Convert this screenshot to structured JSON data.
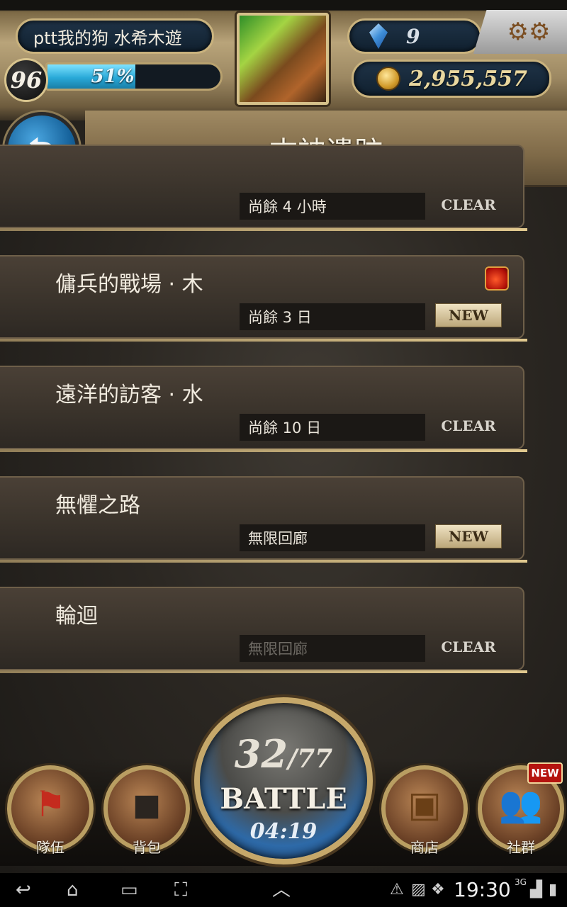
{
  "player": {
    "name": "ptt我的狗 水希木遊",
    "level": "96",
    "exp_text": "51%",
    "exp_fraction": 0.51,
    "gems": "9",
    "coins": "2,955,557"
  },
  "header": {
    "title": "古神遺跡"
  },
  "stages": [
    {
      "title": "",
      "time": "尚餘 4 小時",
      "tag": "CLEAR",
      "tag_type": "clear",
      "has_icon": false
    },
    {
      "title": "傭兵的戰場 · 木",
      "time": "尚餘 3 日",
      "tag": "NEW",
      "tag_type": "new",
      "has_icon": true
    },
    {
      "title": "遠洋的訪客 · 水",
      "time": "尚餘 10 日",
      "tag": "CLEAR",
      "tag_type": "clear",
      "has_icon": false
    },
    {
      "title": "無懼之路",
      "time": "無限回廊",
      "tag": "NEW",
      "tag_type": "new",
      "has_icon": false
    },
    {
      "title": "輪迴",
      "time": "無限回廊",
      "tag": "CLEAR",
      "tag_type": "clear",
      "has_icon": false
    }
  ],
  "nav": {
    "team": "隊伍",
    "bag": "背包",
    "shop": "商店",
    "social": "社群",
    "social_badge": "NEW"
  },
  "battle": {
    "stamina_current": "32",
    "stamina_max": "/77",
    "label": "BATTLE",
    "timer": "04:19"
  },
  "statusbar": {
    "time": "19:30",
    "network": "3G"
  },
  "colors": {
    "accent_gold": "#c9b27d",
    "exp_blue": "#29a9d8",
    "badge_red": "#b5140f"
  },
  "icons": {
    "back": "back-arrow-icon",
    "settings": "gear-icon",
    "gem": "gem-icon",
    "coin": "coin-icon",
    "team": "flag-icon",
    "bag": "bag-icon",
    "shop": "treasure-chest-icon",
    "social": "people-icon",
    "stage_flag": "fire-icon"
  }
}
